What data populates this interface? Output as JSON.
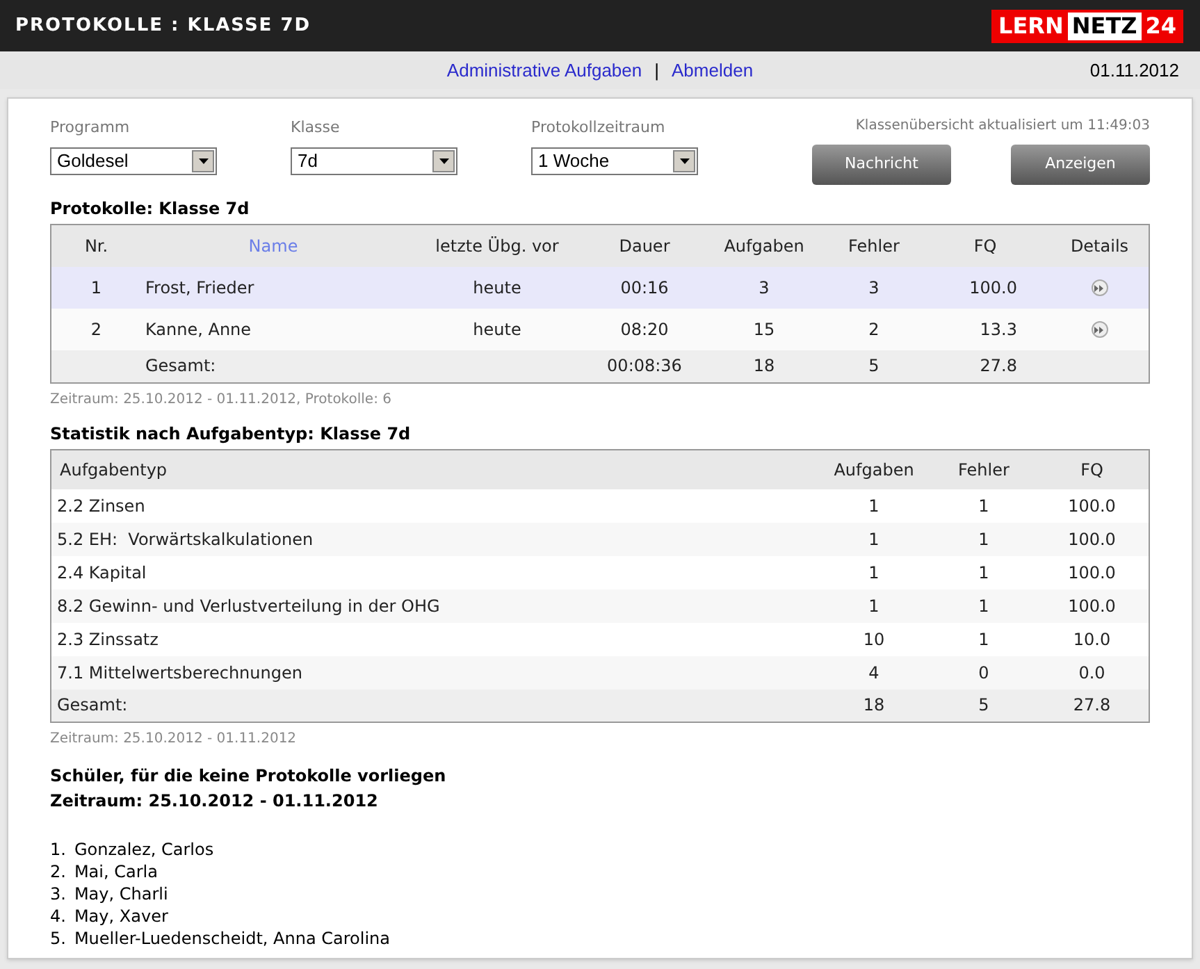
{
  "header": {
    "title": "PROTOKOLLE : KLASSE 7D",
    "logo": [
      "LERN",
      "NETZ",
      "24"
    ]
  },
  "nav": {
    "links": [
      "Administrative Aufgaben",
      "Abmelden"
    ],
    "separator": "|",
    "date": "01.11.2012"
  },
  "filters": [
    {
      "label": "Programm",
      "value": "Goldesel"
    },
    {
      "label": "Klasse",
      "value": "7d"
    },
    {
      "label": "Protokollzeitraum",
      "value": "1 Woche"
    }
  ],
  "update_note": "Klassenübersicht aktualisiert um 11:49:03",
  "buttons": [
    "Nachricht",
    "Anzeigen"
  ],
  "protocols": {
    "title": "Protokolle: Klasse 7d",
    "columns": [
      "Nr.",
      "Name",
      "letzte Übg. vor",
      "Dauer",
      "Aufgaben",
      "Fehler",
      "FQ",
      "Details"
    ],
    "rows": [
      {
        "nr": "1",
        "name": "Frost, Frieder",
        "last": "heute",
        "duration": "00:16",
        "tasks": "3",
        "errors": "3",
        "fq": "100.0",
        "selected": true
      },
      {
        "nr": "2",
        "name": "Kanne, Anne",
        "last": "heute",
        "duration": "08:20",
        "tasks": "15",
        "errors": "2",
        "fq": "13.3",
        "selected": false
      }
    ],
    "total": {
      "label": "Gesamt:",
      "duration": "00:08:36",
      "tasks": "18",
      "errors": "5",
      "fq": "27.8"
    },
    "note": "Zeitraum: 25.10.2012 - 01.11.2012, Protokolle: 6"
  },
  "stats": {
    "title": "Statistik nach Aufgabentyp: Klasse 7d",
    "columns": [
      "Aufgabentyp",
      "Aufgaben",
      "Fehler",
      "FQ"
    ],
    "rows": [
      [
        "2.2 Zinsen",
        "1",
        "1",
        "100.0"
      ],
      [
        "5.2 EH:  Vorwärtskalkulationen",
        "1",
        "1",
        "100.0"
      ],
      [
        "2.4 Kapital",
        "1",
        "1",
        "100.0"
      ],
      [
        "8.2 Gewinn- und Verlustverteilung in der OHG",
        "1",
        "1",
        "100.0"
      ],
      [
        "2.3 Zinssatz",
        "10",
        "1",
        "10.0"
      ],
      [
        "7.1 Mittelwertsberechnungen",
        "4",
        "0",
        "0.0"
      ]
    ],
    "total": [
      "Gesamt:",
      "18",
      "5",
      "27.8"
    ],
    "note": "Zeitraum: 25.10.2012 - 01.11.2012"
  },
  "missing": {
    "title": "Schüler, für die keine Protokolle vorliegen",
    "period": "Zeitraum: 25.10.2012 - 01.11.2012",
    "students": [
      {
        "number": "1.",
        "name": "Gonzalez, Carlos"
      },
      {
        "number": "2.",
        "name": "Mai, Carla"
      },
      {
        "number": "3.",
        "name": "May, Charli"
      },
      {
        "number": "4.",
        "name": "May, Xaver"
      },
      {
        "number": "5.",
        "name": "Mueller-Luedenscheidt, Anna Carolina"
      }
    ]
  }
}
